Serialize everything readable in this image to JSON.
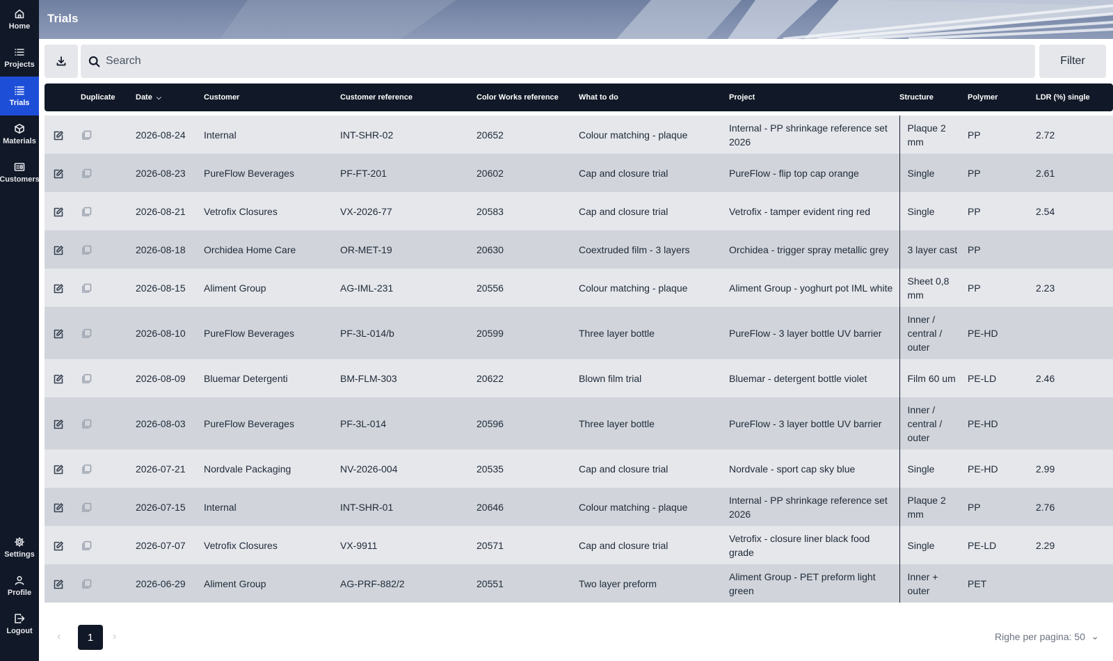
{
  "page": {
    "title": "Trials"
  },
  "sidebar": {
    "top": [
      {
        "label": "Home",
        "icon": "home-icon"
      },
      {
        "label": "Projects",
        "icon": "list-icon"
      },
      {
        "label": "Trials",
        "icon": "list-icon",
        "active": true
      },
      {
        "label": "Materials",
        "icon": "box-icon"
      },
      {
        "label": "Customers",
        "icon": "id-card-icon"
      }
    ],
    "bottom": [
      {
        "label": "Settings",
        "icon": "gear-icon"
      },
      {
        "label": "Profile",
        "icon": "user-icon"
      },
      {
        "label": "Logout",
        "icon": "logout-icon"
      }
    ]
  },
  "toolbar": {
    "search_placeholder": "Search",
    "filter_label": "Filter",
    "download_icon": "download-icon"
  },
  "table": {
    "columns": {
      "duplicate": "Duplicate",
      "date": "Date",
      "customer": "Customer",
      "customer_ref": "Customer reference",
      "cw_ref": "Color Works reference",
      "what_to_do": "What to do",
      "project": "Project",
      "structure": "Structure",
      "polymer": "Polymer",
      "ldr": "LDR (%) single"
    },
    "rows": [
      {
        "date": "2026-08-24",
        "customer": "Internal",
        "customer_ref": "INT-SHR-02",
        "cw_ref": "20652",
        "what": "Colour matching - plaque",
        "project": "Internal - PP shrinkage reference set 2026",
        "structure": "Plaque 2 mm",
        "polymer": "PP",
        "ldr": "2.72"
      },
      {
        "date": "2026-08-23",
        "customer": "PureFlow Beverages",
        "customer_ref": "PF-FT-201",
        "cw_ref": "20602",
        "what": "Cap and closure trial",
        "project": "PureFlow - flip top cap orange",
        "structure": "Single",
        "polymer": "PP",
        "ldr": "2.61"
      },
      {
        "date": "2026-08-21",
        "customer": "Vetrofix Closures",
        "customer_ref": "VX-2026-77",
        "cw_ref": "20583",
        "what": "Cap and closure trial",
        "project": "Vetrofix - tamper evident ring red",
        "structure": "Single",
        "polymer": "PP",
        "ldr": "2.54"
      },
      {
        "date": "2026-08-18",
        "customer": "Orchidea Home Care",
        "customer_ref": "OR-MET-19",
        "cw_ref": "20630",
        "what": "Coextruded film - 3 layers",
        "project": "Orchidea - trigger spray metallic grey",
        "structure": "3 layer cast",
        "polymer": "PP",
        "ldr": ""
      },
      {
        "date": "2026-08-15",
        "customer": "Aliment Group",
        "customer_ref": "AG-IML-231",
        "cw_ref": "20556",
        "what": "Colour matching - plaque",
        "project": "Aliment Group - yoghurt pot IML white",
        "structure": "Sheet 0,8 mm",
        "polymer": "PP",
        "ldr": "2.23"
      },
      {
        "date": "2026-08-10",
        "customer": "PureFlow Beverages",
        "customer_ref": "PF-3L-014/b",
        "cw_ref": "20599",
        "what": "Three layer bottle",
        "project": "PureFlow - 3 layer bottle UV barrier",
        "structure": "Inner / central / outer",
        "polymer": "PE-HD",
        "ldr": ""
      },
      {
        "date": "2026-08-09",
        "customer": "Bluemar Detergenti",
        "customer_ref": "BM-FLM-303",
        "cw_ref": "20622",
        "what": "Blown film trial",
        "project": "Bluemar - detergent bottle violet",
        "structure": "Film 60 um",
        "polymer": "PE-LD",
        "ldr": "2.46"
      },
      {
        "date": "2026-08-03",
        "customer": "PureFlow Beverages",
        "customer_ref": "PF-3L-014",
        "cw_ref": "20596",
        "what": "Three layer bottle",
        "project": "PureFlow - 3 layer bottle UV barrier",
        "structure": "Inner / central / outer",
        "polymer": "PE-HD",
        "ldr": ""
      },
      {
        "date": "2026-07-21",
        "customer": "Nordvale Packaging",
        "customer_ref": "NV-2026-004",
        "cw_ref": "20535",
        "what": "Cap and closure trial",
        "project": "Nordvale - sport cap sky blue",
        "structure": "Single",
        "polymer": "PE-HD",
        "ldr": "2.99"
      },
      {
        "date": "2026-07-15",
        "customer": "Internal",
        "customer_ref": "INT-SHR-01",
        "cw_ref": "20646",
        "what": "Colour matching - plaque",
        "project": "Internal - PP shrinkage reference set 2026",
        "structure": "Plaque 2 mm",
        "polymer": "PP",
        "ldr": "2.76"
      },
      {
        "date": "2026-07-07",
        "customer": "Vetrofix Closures",
        "customer_ref": "VX-9911",
        "cw_ref": "20571",
        "what": "Cap and closure trial",
        "project": "Vetrofix - closure liner black food grade",
        "structure": "Single",
        "polymer": "PE-LD",
        "ldr": "2.29"
      },
      {
        "date": "2026-06-29",
        "customer": "Aliment Group",
        "customer_ref": "AG-PRF-882/2",
        "cw_ref": "20551",
        "what": "Two layer preform",
        "project": "Aliment Group - PET preform light green",
        "structure": "Inner + outer",
        "polymer": "PET",
        "ldr": ""
      }
    ]
  },
  "pagination": {
    "current_page": "1",
    "prev_icon": "chevron-left-icon",
    "next_icon": "chevron-right-icon",
    "rows_per_page_label": "Righe per pagina: 50"
  }
}
